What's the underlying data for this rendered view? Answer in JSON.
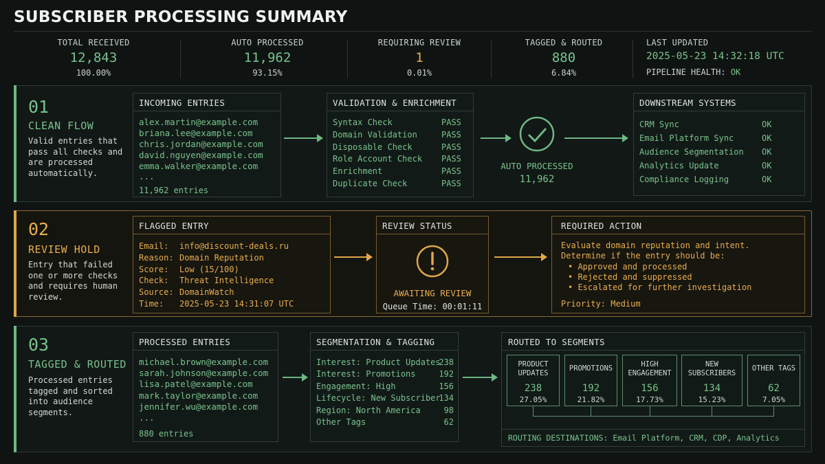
{
  "title": "SUBSCRIBER PROCESSING SUMMARY",
  "metrics": [
    {
      "label": "TOTAL RECEIVED",
      "value": "12,843",
      "pct": "100.00%"
    },
    {
      "label": "AUTO PROCESSED",
      "value": "11,962",
      "pct": "93.15%"
    },
    {
      "label": "REQUIRING REVIEW",
      "value": "1",
      "pct": "0.01%"
    },
    {
      "label": "TAGGED & ROUTED",
      "value": "880",
      "pct": "6.84%"
    }
  ],
  "last_updated": {
    "label": "LAST UPDATED",
    "value": "2025-05-23 14:32:18 UTC",
    "health_label": "PIPELINE HEALTH:",
    "health_value": "OK"
  },
  "s1": {
    "num": "01",
    "name": "CLEAN FLOW",
    "desc": "Valid entries that pass all checks and are processed automatically.",
    "incoming": {
      "title": "INCOMING ENTRIES",
      "entries": [
        "alex.martin@example.com",
        "briana.lee@example.com",
        "chris.jordan@example.com",
        "david.nguyen@example.com",
        "emma.walker@example.com",
        "..."
      ],
      "count": "11,962 entries"
    },
    "validation": {
      "title": "VALIDATION & ENRICHMENT",
      "checks": [
        {
          "name": "Syntax Check",
          "status": "PASS"
        },
        {
          "name": "Domain Validation",
          "status": "PASS"
        },
        {
          "name": "Disposable Check",
          "status": "PASS"
        },
        {
          "name": "Role Account Check",
          "status": "PASS"
        },
        {
          "name": "Enrichment",
          "status": "PASS"
        },
        {
          "name": "Duplicate Check",
          "status": "PASS"
        }
      ]
    },
    "auto": {
      "label": "AUTO PROCESSED",
      "value": "11,962"
    },
    "downstream": {
      "title": "DOWNSTREAM SYSTEMS",
      "systems": [
        {
          "name": "CRM Sync",
          "status": "OK"
        },
        {
          "name": "Email Platform Sync",
          "status": "OK"
        },
        {
          "name": "Audience Segmentation",
          "status": "OK"
        },
        {
          "name": "Analytics Update",
          "status": "OK"
        },
        {
          "name": "Compliance Logging",
          "status": "OK"
        }
      ]
    }
  },
  "s2": {
    "num": "02",
    "name": "REVIEW HOLD",
    "desc": "Entry that failed one or more checks and requires human review.",
    "flagged": {
      "title": "FLAGGED ENTRY",
      "fields": [
        {
          "k": "Email:",
          "v": "info@discount-deals.ru"
        },
        {
          "k": "Reason:",
          "v": "Domain Reputation"
        },
        {
          "k": "Score:",
          "v": "Low (15/100)"
        },
        {
          "k": "Check:",
          "v": "Threat Intelligence"
        },
        {
          "k": "Source:",
          "v": "DomainWatch"
        },
        {
          "k": "Time:",
          "v": "2025-05-23 14:31:07 UTC"
        }
      ]
    },
    "review": {
      "title": "REVIEW STATUS",
      "status": "AWAITING REVIEW",
      "queue": "Queue Time: 00:01:11"
    },
    "action": {
      "title": "REQUIRED ACTION",
      "line1": "Evaluate domain reputation and intent.",
      "line2": "Determine if the entry should be:",
      "options": [
        "Approved and processed",
        "Rejected and suppressed",
        "Escalated for further investigation"
      ],
      "priority": "Priority: Medium"
    }
  },
  "s3": {
    "num": "03",
    "name": "TAGGED & ROUTED",
    "desc": "Processed entries tagged and sorted into audience segments.",
    "processed": {
      "title": "PROCESSED ENTRIES",
      "entries": [
        "michael.brown@example.com",
        "sarah.johnson@example.com",
        "lisa.patel@example.com",
        "mark.taylor@example.com",
        "jennifer.wu@example.com",
        "..."
      ],
      "count": "880 entries"
    },
    "tagging": {
      "title": "SEGMENTATION & TAGGING",
      "tags": [
        {
          "name": "Interest: Product Updates",
          "count": "238"
        },
        {
          "name": "Interest: Promotions",
          "count": "192"
        },
        {
          "name": "Engagement: High",
          "count": "156"
        },
        {
          "name": "Lifecycle: New Subscriber",
          "count": "134"
        },
        {
          "name": "Region: North America",
          "count": "98"
        },
        {
          "name": "Other Tags",
          "count": "62"
        }
      ]
    },
    "routed": {
      "title": "ROUTED TO SEGMENTS",
      "segments": [
        {
          "l1": "PRODUCT",
          "l2": "UPDATES",
          "value": "238",
          "pct": "27.05%"
        },
        {
          "l1": "PROMOTIONS",
          "l2": "",
          "value": "192",
          "pct": "21.82%"
        },
        {
          "l1": "HIGH",
          "l2": "ENGAGEMENT",
          "value": "156",
          "pct": "17.73%"
        },
        {
          "l1": "NEW",
          "l2": "SUBSCRIBERS",
          "value": "134",
          "pct": "15.23%"
        },
        {
          "l1": "OTHER TAGS",
          "l2": "",
          "value": "62",
          "pct": "7.05%"
        }
      ],
      "destinations": "ROUTING DESTINATIONS: Email Platform, CRM, CDP, Analytics"
    }
  },
  "colors": {
    "green": "#7ac28c",
    "amber": "#e8ad4e",
    "background": "#0f1413"
  },
  "icons": {
    "auto": "check-circle-icon",
    "review": "exclamation-circle-icon"
  }
}
